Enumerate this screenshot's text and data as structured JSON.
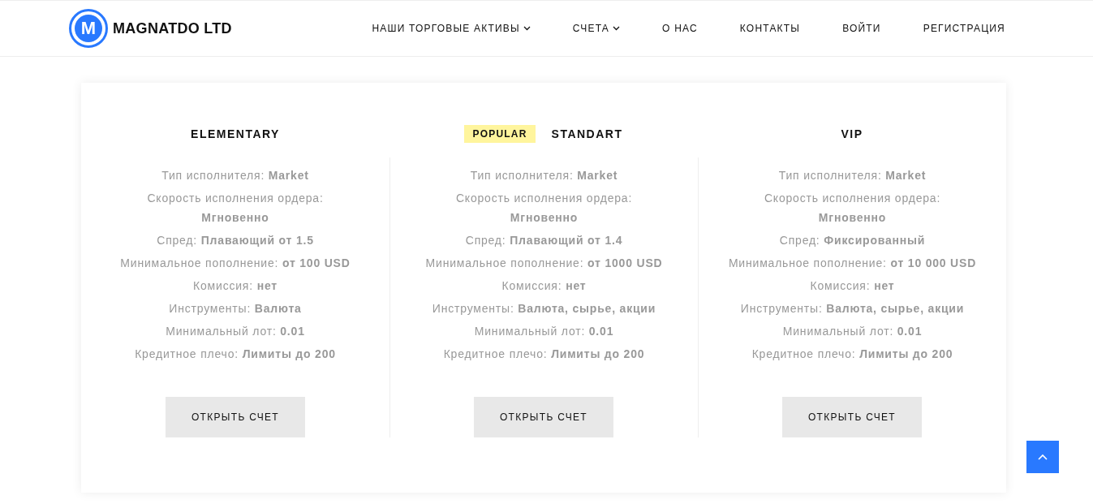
{
  "header": {
    "logo": {
      "mark": "M",
      "name": "MAGNATDO LTD"
    },
    "nav": [
      {
        "label": "НАШИ ТОРГОВЫЕ АКТИВЫ",
        "dropdown": true
      },
      {
        "label": "СЧЕТА",
        "dropdown": true
      },
      {
        "label": "О НАС",
        "dropdown": false
      },
      {
        "label": "КОНТАКТЫ",
        "dropdown": false
      },
      {
        "label": "ВОЙТИ",
        "dropdown": false
      },
      {
        "label": "РЕГИСТРАЦИЯ",
        "dropdown": false
      }
    ]
  },
  "plans": [
    {
      "title": "ELEMENTARY",
      "features": [
        {
          "kind": "inline",
          "text": "Тип исполнителя: **Market**"
        },
        {
          "kind": "stacked",
          "text": "Скорость исполнения ордера: **Мгновенно**"
        },
        {
          "kind": "inline",
          "text": "Спред: **Плавающий от 1.5**"
        },
        {
          "kind": "inline",
          "text": "Минимальное пополнение: **от 100 USD**"
        },
        {
          "kind": "inline",
          "text": "Комиссия: **нет**"
        },
        {
          "kind": "inline",
          "text": "Инструменты: **Валюта**"
        },
        {
          "kind": "inline",
          "text": "Минимальный лот: **0.01**"
        },
        {
          "kind": "inline",
          "text": "Кредитное плечо: **Лимиты до 200**"
        }
      ],
      "button": "ОТКРЫТЬ СЧЕТ"
    },
    {
      "badge": "POPULAR",
      "title": "STANDART",
      "features": [
        {
          "kind": "inline",
          "text": "Тип исполнителя: **Market**"
        },
        {
          "kind": "stacked",
          "text": "Скорость исполнения ордера: **Мгновенно**"
        },
        {
          "kind": "inline",
          "text": "Спред: **Плавающий от 1.4**"
        },
        {
          "kind": "inline",
          "text": "Минимальное пополнение: **от 1000 USD**"
        },
        {
          "kind": "inline",
          "text": "Комиссия: **нет**"
        },
        {
          "kind": "inline",
          "text": "Инструменты: **Валюта, сырье, акции**"
        },
        {
          "kind": "inline",
          "text": "Минимальный лот: **0.01**"
        },
        {
          "kind": "inline",
          "text": "Кредитное плечо: **Лимиты до 200**"
        }
      ],
      "button": "ОТКРЫТЬ СЧЕТ"
    },
    {
      "title": "VIP",
      "features": [
        {
          "kind": "inline",
          "text": "Тип исполнителя: **Market**"
        },
        {
          "kind": "stacked",
          "text": "Скорость исполнения ордера: **Мгновенно**"
        },
        {
          "kind": "inline",
          "text": "Спред: **Фиксированный**"
        },
        {
          "kind": "inline",
          "text": "Минимальное пополнение: **от 10 000 USD**"
        },
        {
          "kind": "inline",
          "text": "Комиссия: **нет**"
        },
        {
          "kind": "inline",
          "text": "Инструменты: **Валюта, сырье, акции**"
        },
        {
          "kind": "inline",
          "text": "Минимальный лот: **0.01**"
        },
        {
          "kind": "inline",
          "text": "Кредитное плечо: **Лимиты до 200**"
        }
      ],
      "button": "ОТКРЫТЬ СЧЕТ"
    }
  ]
}
